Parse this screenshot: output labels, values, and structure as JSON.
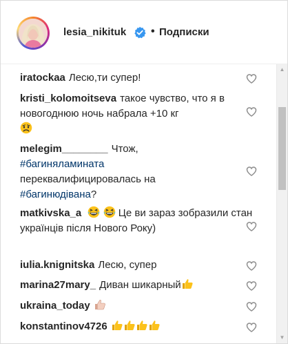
{
  "header": {
    "username": "lesia_nikituk",
    "separator": "•",
    "follow_label": "Подписки",
    "verified_color": "#3897f0"
  },
  "comments": [
    {
      "user": "iratockaa",
      "text": "Лесю,ти супер!"
    },
    {
      "user": "kristi_kolomoitseva",
      "text": "такое чувство, что я в новогоднюю ночь набрала +10 кг",
      "emoji": "disappointed-face"
    },
    {
      "user": "melegim________",
      "text_a": "Чтож,",
      "tag_1": "#багиняламината",
      "text_b": "переквалифицировалась на",
      "tag_2": "#багинюдівана",
      "text_c": "?"
    },
    {
      "user": "matkivska_a",
      "emoji": "laughing-face-x2",
      "text": "Це ви зараз зобразили стан українців після Нового Року)"
    },
    {
      "user": "iulia.knignitska",
      "text": "Лесю, супер"
    },
    {
      "user": "marina27mary_",
      "text": "Диван шикарный",
      "emoji": "thumbs-up"
    },
    {
      "user": "ukraina_today",
      "emoji": "thumbs-up-light"
    },
    {
      "user": "konstantinov4726",
      "emoji": "thumbs-up-x4"
    }
  ],
  "icons": {
    "like": "heart-outline-icon",
    "verified": "verified-badge-icon"
  }
}
